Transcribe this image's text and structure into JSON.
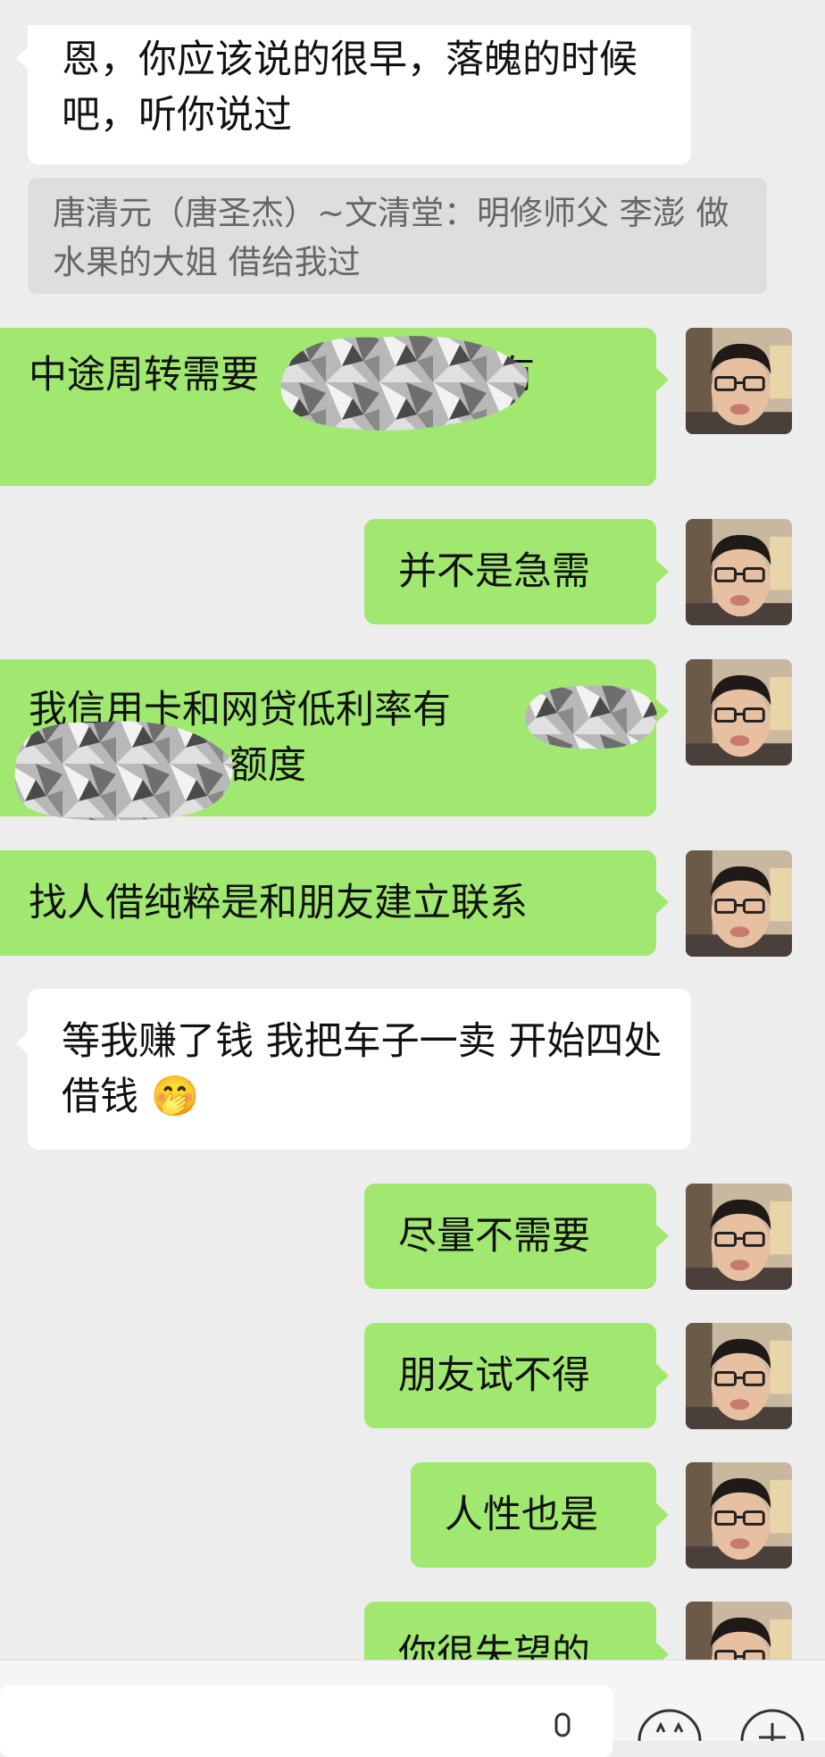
{
  "messages": [
    {
      "side": "left",
      "text": "恩，你应该说的很早，落魄的时候吧，听你说过"
    },
    {
      "side": "left",
      "quote": "唐清元（唐圣杰）~文清堂：明修师父 李澎 做水果的大姐 借给我过"
    },
    {
      "side": "right",
      "text_before": "中途周转需要",
      "text_after": "那是有"
    },
    {
      "side": "right",
      "text": "并不是急需"
    },
    {
      "side": "right",
      "text_before": "我信用卡和网贷低利率有",
      "text_after": "额度"
    },
    {
      "side": "right",
      "text": "找人借纯粹是和朋友建立联系"
    },
    {
      "side": "left",
      "text": "等我赚了钱 我把车子一卖  开始四处借钱",
      "emoji": "🤭"
    },
    {
      "side": "right",
      "text": "尽量不需要"
    },
    {
      "side": "right",
      "text": "朋友试不得"
    },
    {
      "side": "right",
      "text": "人性也是"
    },
    {
      "side": "right",
      "text": "你很失望的"
    }
  ],
  "input_bar": {
    "voice_icon": "microphone-icon",
    "emoji_icon": "emoji-icon",
    "more_icon": "plus-icon"
  },
  "colors": {
    "background": "#ededed",
    "self_bubble": "#a0e870",
    "other_bubble": "#ffffff",
    "quote_bg": "#dedede"
  }
}
